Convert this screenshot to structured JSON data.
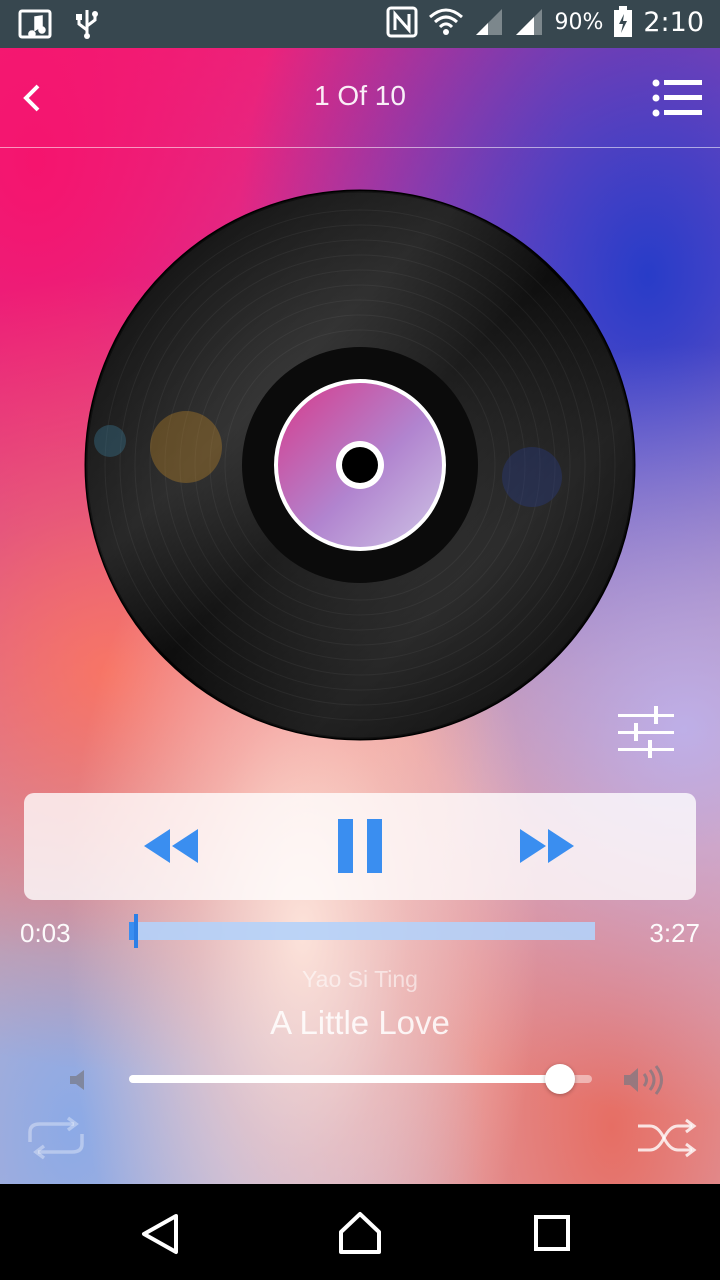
{
  "status_bar": {
    "battery_percent": "90%",
    "time": "2:10",
    "icons": [
      "music-notification-icon",
      "usb-icon",
      "nfc-icon",
      "wifi-icon",
      "signal-icon",
      "signal-icon",
      "battery-charging-icon"
    ]
  },
  "header": {
    "title": "1 Of 10",
    "back_icon": "chevron-left-icon",
    "menu_icon": "playlist-icon"
  },
  "player": {
    "equalizer_icon": "equalizer-icon",
    "controls": {
      "prev_icon": "rewind-icon",
      "pause_icon": "pause-icon",
      "next_icon": "fast-forward-icon"
    },
    "progress": {
      "current": "0:03",
      "total": "3:27",
      "fraction": 0.015
    },
    "artist": "Yao Si Ting",
    "song_title": "A Little Love",
    "volume_fraction": 0.93,
    "repeat_icon": "repeat-icon",
    "shuffle_icon": "shuffle-icon"
  },
  "nav_bar": {
    "icons": [
      "back-triangle-icon",
      "home-icon",
      "recents-icon"
    ]
  },
  "colors": {
    "accent": "#3a8ef0",
    "statusbar": "#37474f"
  }
}
